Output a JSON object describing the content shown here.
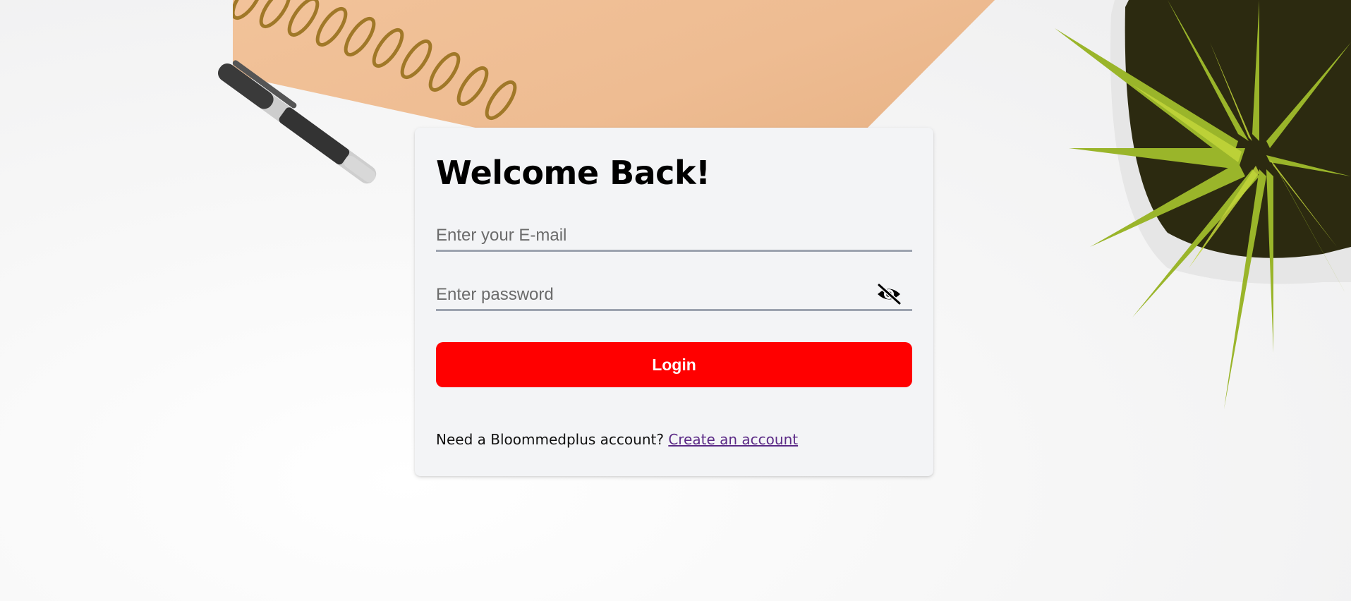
{
  "login": {
    "title": "Welcome Back!",
    "email_placeholder": "Enter your E-mail",
    "email_value": "",
    "password_placeholder": "Enter password",
    "password_value": "",
    "toggle_icon": "eye-slash-icon",
    "login_label": "Login",
    "signup_prompt": "Need a Bloommedplus account?",
    "signup_link": "Create an account"
  },
  "colors": {
    "accent": "#ff0000",
    "card_bg": "#f3f4f6",
    "link": "#5b2a86",
    "underline": "#9ca3af"
  }
}
